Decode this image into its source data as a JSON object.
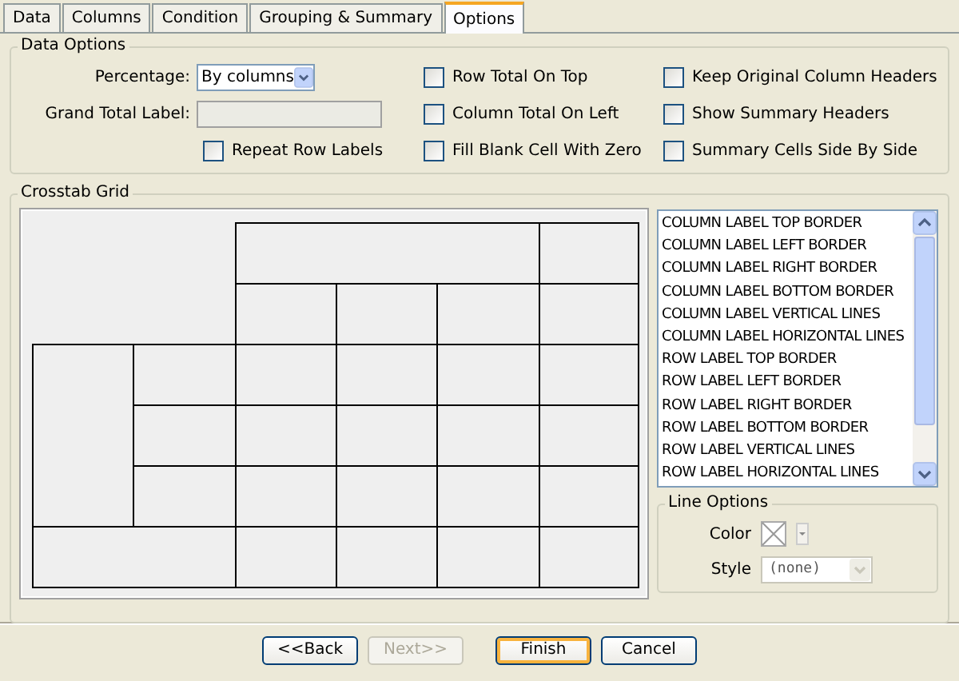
{
  "tabs": [
    {
      "label": "Data",
      "selected": false
    },
    {
      "label": "Columns",
      "selected": false
    },
    {
      "label": "Condition",
      "selected": false
    },
    {
      "label": "Grouping & Summary",
      "selected": false
    },
    {
      "label": "Options",
      "selected": true
    }
  ],
  "data_options": {
    "title": "Data Options",
    "percentage": {
      "label": "Percentage:",
      "value": "By columns"
    },
    "grand_total_label": {
      "label": "Grand Total Label:",
      "disabled": true
    },
    "checkbox_columns": [
      [
        {
          "label": "Repeat Row Labels",
          "checked": false
        }
      ],
      [
        {
          "label": "Row Total On Top",
          "checked": false
        },
        {
          "label": "Column Total On Left",
          "checked": false
        },
        {
          "label": "Fill Blank Cell With Zero",
          "checked": false
        }
      ],
      [
        {
          "label": "Keep Original Column Headers",
          "checked": false
        },
        {
          "label": "Show Summary Headers",
          "checked": false
        },
        {
          "label": "Summary Cells Side By Side",
          "checked": false
        }
      ]
    ]
  },
  "crosstab_grid": {
    "title": "Crosstab Grid",
    "lines": [
      {
        "label": "COLUMN LABEL TOP BORDER",
        "selected": false
      },
      {
        "label": "COLUMN LABEL LEFT BORDER",
        "selected": false
      },
      {
        "label": "COLUMN LABEL RIGHT BORDER",
        "selected": false
      },
      {
        "label": "COLUMN LABEL BOTTOM BORDER",
        "selected": false
      },
      {
        "label": "COLUMN LABEL VERTICAL LINES",
        "selected": false
      },
      {
        "label": "COLUMN LABEL HORIZONTAL LINES",
        "selected": false
      },
      {
        "label": "ROW LABEL TOP BORDER",
        "selected": false
      },
      {
        "label": "ROW LABEL LEFT BORDER",
        "selected": false
      },
      {
        "label": "ROW LABEL RIGHT BORDER",
        "selected": false
      },
      {
        "label": "ROW LABEL BOTTOM BORDER",
        "selected": false
      },
      {
        "label": "ROW LABEL VERTICAL LINES",
        "selected": false
      },
      {
        "label": "ROW LABEL HORIZONTAL LINES",
        "selected": false
      }
    ],
    "line_options": {
      "title": "Line Options",
      "color_label": "Color",
      "style_label": "Style",
      "style_value": "(none)",
      "style_disabled": true
    }
  },
  "buttons": [
    {
      "label": "<<Back",
      "disabled": false,
      "default": false
    },
    {
      "label": "Next>>",
      "disabled": true,
      "default": false
    },
    {
      "label": "Finish",
      "disabled": false,
      "default": true
    },
    {
      "label": "Cancel",
      "disabled": false,
      "default": false
    }
  ]
}
